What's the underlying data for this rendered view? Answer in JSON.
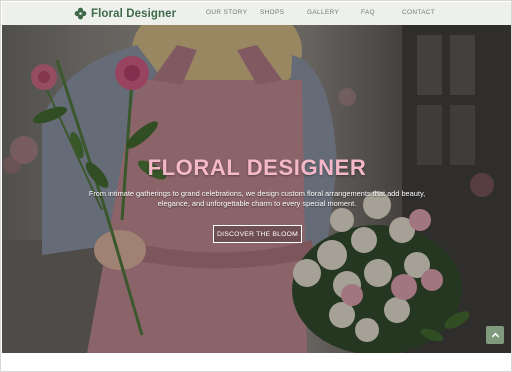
{
  "brand": {
    "name": "Floral Designer",
    "logo_icon": "flower-clover-icon",
    "color": "#3f6a4a"
  },
  "nav": {
    "items": [
      {
        "label": "OUR STORY"
      },
      {
        "label": "SHOPS"
      },
      {
        "label": "GALLERY"
      },
      {
        "label": "FAQ"
      },
      {
        "label": "CONTACT"
      }
    ]
  },
  "hero": {
    "title": "FLORAL DESIGNER",
    "subtitle": "From intimate gatherings to grand celebrations, we design custom floral arrangements that add beauty, elegance, and unforgettable charm to every special moment.",
    "cta_label": "DISCOVER THE BLOOM",
    "title_color": "#f4b8c8"
  },
  "back_to_top": {
    "icon": "chevron-up-icon",
    "color": "#7f9a7c"
  }
}
